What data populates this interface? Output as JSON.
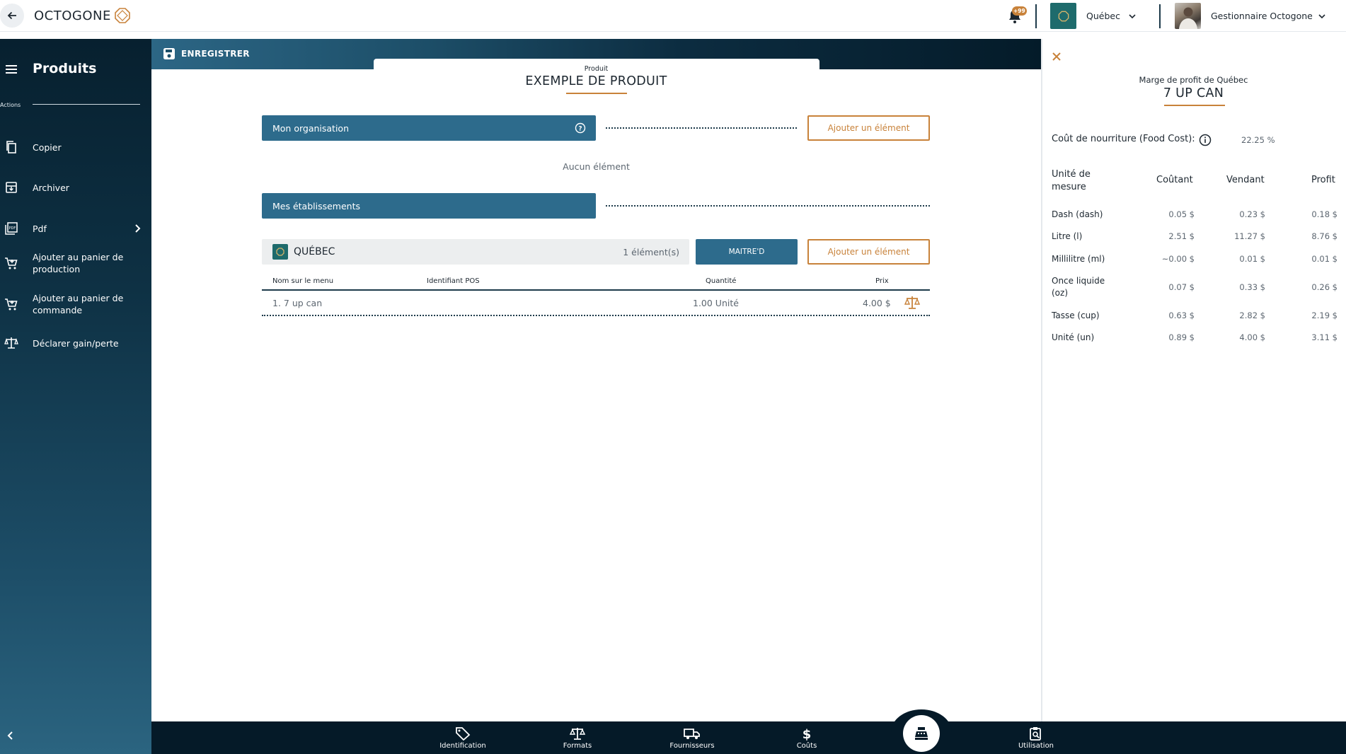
{
  "header": {
    "logo_text": "OCTOGONE",
    "notification_badge": "+99",
    "site_name": "Québec",
    "user_name": "Gestionnaire Octogone"
  },
  "sidebar": {
    "title": "Produits",
    "actions_label": "Actions",
    "items": [
      {
        "label": "Copier",
        "icon": "copy-icon"
      },
      {
        "label": "Archiver",
        "icon": "archive-icon"
      },
      {
        "label": "Pdf",
        "icon": "pdf-icon"
      },
      {
        "label": "Ajouter au panier de production",
        "icon": "cart-icon"
      },
      {
        "label": "Ajouter au panier de commande",
        "icon": "cart-icon"
      },
      {
        "label": "Déclarer gain/perte",
        "icon": "scale-icon"
      }
    ]
  },
  "toolbar": {
    "save_label": "ENREGISTRER"
  },
  "product": {
    "kicker": "Produit",
    "title": "EXEMPLE DE PRODUIT"
  },
  "organisation": {
    "section_label": "Mon organisation",
    "add_label": "Ajouter un élément",
    "empty_text": "Aucun élément"
  },
  "establishments": {
    "section_label": "Mes établissements",
    "row_name": "QUÉBEC",
    "row_count": "1 élément(s)",
    "pos_button": "MAITRE'D",
    "add_label": "Ajouter un élément",
    "columns": [
      "Nom sur le menu",
      "Identifiant POS",
      "Quantité",
      "Prix"
    ],
    "rows": [
      {
        "name": "1. 7 up can",
        "pos_id": "",
        "quantity": "1.00 Unité",
        "price": "4.00 $"
      }
    ]
  },
  "bottom_nav": {
    "items": [
      {
        "label": "Identification",
        "icon": "tag-icon"
      },
      {
        "label": "Formats",
        "icon": "scale-icon"
      },
      {
        "label": "Fournisseurs",
        "icon": "truck-icon"
      },
      {
        "label": "Coûts",
        "icon": "dollar-icon"
      },
      {
        "label": "",
        "icon": "cash-register-icon"
      },
      {
        "label": "Utilisation",
        "icon": "clipboard-search-icon"
      }
    ]
  },
  "margin_panel": {
    "title": "Marge de profit de Québec",
    "product": "7 UP CAN",
    "food_cost_label": "Coût de nourriture (Food Cost):",
    "food_cost_value": "22.25 %",
    "columns": [
      "Unité de mesure",
      "Coûtant",
      "Vendant",
      "Profit"
    ],
    "rows": [
      {
        "unit": "Dash (dash)",
        "cost": "0.05 $",
        "sell": "0.23 $",
        "profit": "0.18 $"
      },
      {
        "unit": "Litre (l)",
        "cost": "2.51 $",
        "sell": "11.27 $",
        "profit": "8.76 $"
      },
      {
        "unit": "Millilitre (ml)",
        "cost": "~0.00 $",
        "sell": "0.01 $",
        "profit": "0.01 $"
      },
      {
        "unit": "Once liquide (oz)",
        "cost": "0.07 $",
        "sell": "0.33 $",
        "profit": "0.26 $"
      },
      {
        "unit": "Tasse (cup)",
        "cost": "0.63 $",
        "sell": "2.82 $",
        "profit": "2.19 $"
      },
      {
        "unit": "Unité (un)",
        "cost": "0.89 $",
        "sell": "4.00 $",
        "profit": "3.11 $"
      }
    ]
  },
  "colors": {
    "accent": "#c8823a",
    "primary": "#2d6b8c",
    "navy": "#051a28",
    "site": "#1e6b6c"
  }
}
